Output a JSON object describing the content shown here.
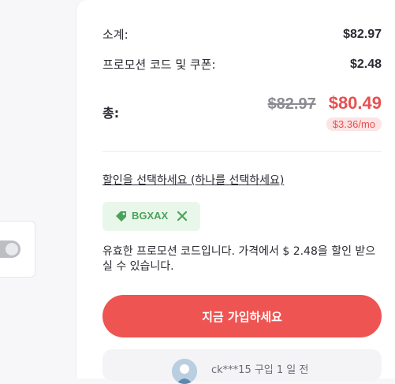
{
  "summary": {
    "subtotal_label": "소계:",
    "subtotal_value": "$82.97",
    "promo_label": "프로모션 코드 및 쿠폰:",
    "promo_value": "$2.48",
    "total_label": "총:",
    "old_price": "$82.97",
    "new_price": "$80.49",
    "monthly": "$3.36/mo"
  },
  "discount": {
    "link_label": "할인을 선택하세요 (하나를 선택하세요)",
    "coupon_code": "BGXAX",
    "message": "유효한 프로모션 코드입니다. 가격에서 $ 2.48을 할인 받으실 수 있습니다."
  },
  "cta": {
    "label": "지금 가입하세요"
  },
  "recent_purchase": {
    "text": "ck***15 구입 1 일 전"
  },
  "colors": {
    "accent": "#ee5451",
    "price_red": "#e8504f",
    "coupon_green": "#4aa25a",
    "coupon_bg": "#e9f7ea"
  },
  "icons": [
    "tag-icon",
    "close-icon",
    "avatar"
  ]
}
